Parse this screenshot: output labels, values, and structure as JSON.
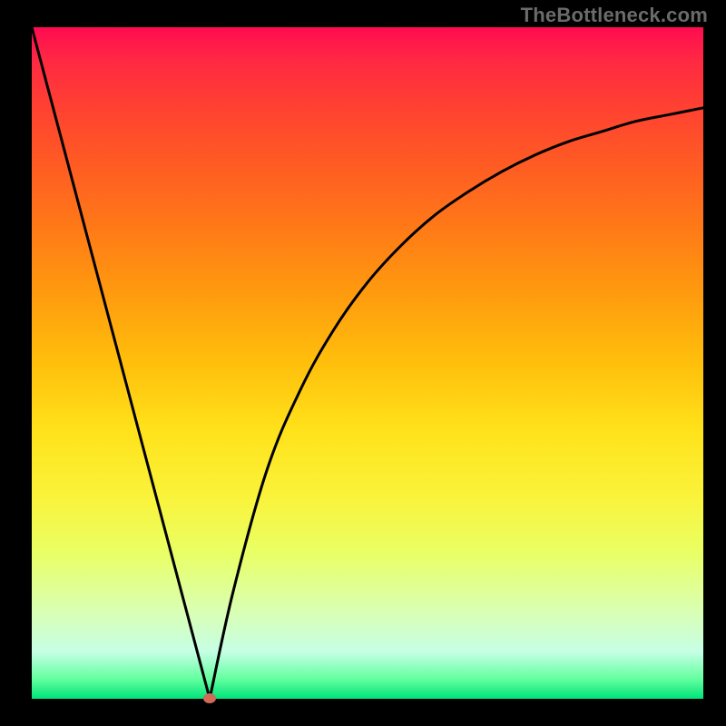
{
  "attribution": "TheBottleneck.com",
  "chart_data": {
    "type": "line",
    "title": "",
    "xlabel": "",
    "ylabel": "",
    "xlim": [
      0,
      100
    ],
    "ylim": [
      0,
      100
    ],
    "grid": false,
    "legend": false,
    "series": [
      {
        "name": "left-line",
        "x": [
          0,
          26.5
        ],
        "values": [
          100,
          0
        ]
      },
      {
        "name": "right-curve",
        "x": [
          26.5,
          30,
          35,
          40,
          45,
          50,
          55,
          60,
          65,
          70,
          75,
          80,
          85,
          90,
          95,
          100
        ],
        "values": [
          0,
          16,
          34,
          46,
          55,
          62,
          67.5,
          72,
          75.5,
          78.5,
          81,
          83,
          84.5,
          86,
          87,
          88
        ]
      }
    ],
    "marker": {
      "x": 26.5,
      "y": 0,
      "color": "#cf6b57"
    },
    "background_gradient": {
      "top": "#ff0b50",
      "mid": "#ffe21a",
      "bottom": "#00e47a"
    }
  }
}
